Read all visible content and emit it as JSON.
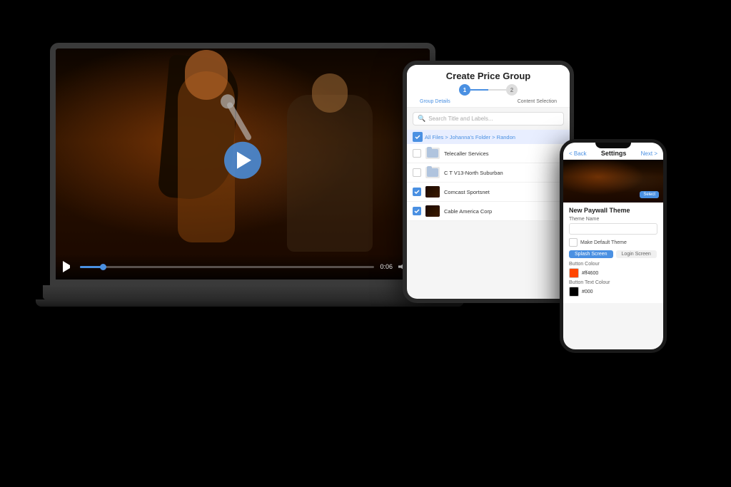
{
  "scene": {
    "background_color": "#000000"
  },
  "laptop": {
    "video": {
      "progress_percent": 8,
      "time": "0:06",
      "total_time": ""
    }
  },
  "tablet": {
    "title": "Create Price Group",
    "steps": [
      {
        "label": "Group Details",
        "active": true,
        "number": "1"
      },
      {
        "label": "Content Selection",
        "active": false,
        "number": "2"
      }
    ],
    "search_placeholder": "Search Title and Labels...",
    "breadcrumb": "All Files > Johanna's Folder > Randon",
    "files": [
      {
        "name": "Telecaller Services",
        "type": "folder",
        "checked": false
      },
      {
        "name": "C T V13-North Suburban",
        "type": "folder",
        "checked": false
      },
      {
        "name": "Comcast Sportsnet",
        "type": "video",
        "checked": true
      },
      {
        "name": "Cable America Corp",
        "type": "video",
        "checked": true
      }
    ]
  },
  "phone": {
    "header": {
      "back_label": "< Back",
      "title": "Settings",
      "next_label": "Next >"
    },
    "section_title": "New Paywall Theme",
    "theme_name_label": "Theme Name",
    "make_default_label": "Make Default Theme",
    "tabs": [
      {
        "label": "Splash Screen",
        "active": true
      },
      {
        "label": "Login Screen",
        "active": false
      }
    ],
    "button_colour_label": "Button Colour",
    "button_colour_value": "#ff4600",
    "button_text_colour_label": "Button Text Colour",
    "button_text_colour_value": "#000"
  }
}
